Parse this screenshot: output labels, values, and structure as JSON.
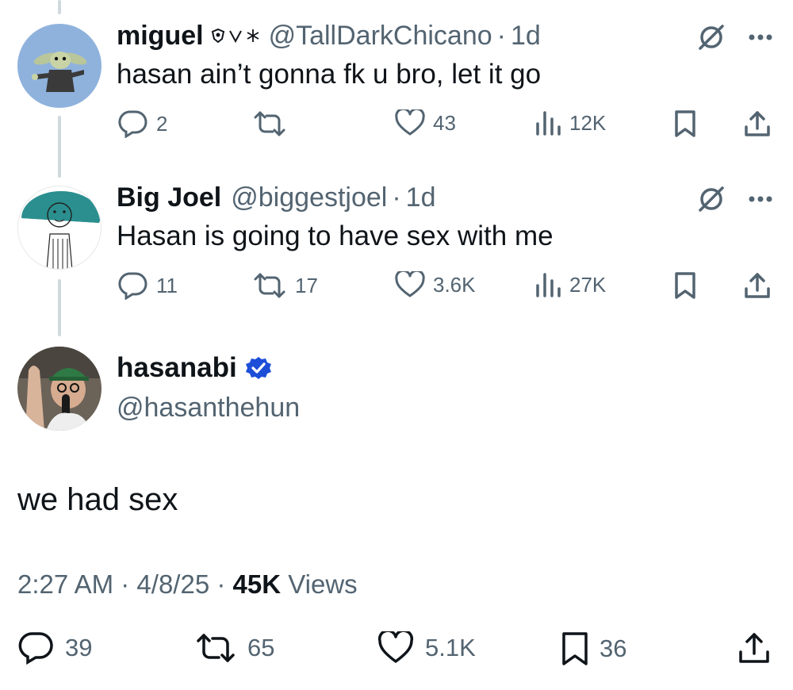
{
  "replies": [
    {
      "name": "miguel",
      "badges": [
        "shield-badge",
        "v",
        "snowflake"
      ],
      "handle": "@TallDarkChicano",
      "separator": "·",
      "time": "1d",
      "text": "hasan ain’t gonna fk u bro, let it go",
      "replies": "2",
      "reposts": "",
      "likes": "43",
      "views": "12K"
    },
    {
      "name": "Big Joel",
      "handle": "@biggestjoel",
      "separator": "·",
      "time": "1d",
      "text": "Hasan is going to have sex with me",
      "replies": "11",
      "reposts": "17",
      "likes": "3.6K",
      "views": "27K"
    }
  ],
  "main_tweet": {
    "name": "hasanabi",
    "handle": "@hasanthehun",
    "text": "we had sex",
    "time": "2:27 AM",
    "date": "4/8/25",
    "separator": "·",
    "views_count": "45K",
    "views_label": "Views",
    "replies": "39",
    "reposts": "65",
    "likes": "5.1K",
    "bookmarks": "36"
  },
  "colors": {
    "text": "#0f1419",
    "secondary": "#536471",
    "thread_line": "#cfd9de",
    "verified": "#1d4ed8"
  }
}
